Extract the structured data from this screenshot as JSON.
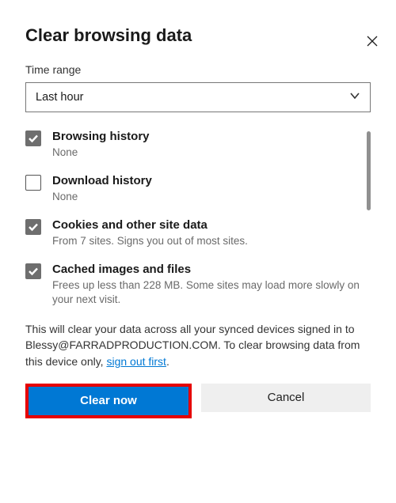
{
  "title": "Clear browsing data",
  "close_icon": "close",
  "time_range": {
    "label": "Time range",
    "value": "Last hour"
  },
  "options": [
    {
      "checked": true,
      "label": "Browsing history",
      "desc": "None"
    },
    {
      "checked": false,
      "label": "Download history",
      "desc": "None"
    },
    {
      "checked": true,
      "label": "Cookies and other site data",
      "desc": "From 7 sites. Signs you out of most sites."
    },
    {
      "checked": true,
      "label": "Cached images and files",
      "desc": "Frees up less than 228 MB. Some sites may load more slowly on your next visit."
    }
  ],
  "summary": {
    "text_before": "This will clear your data across all your synced devices signed in to Blessy@FARRADPRODUCTION.COM. To clear browsing data from this device only, ",
    "link_text": "sign out first",
    "text_after": "."
  },
  "buttons": {
    "primary": "Clear now",
    "secondary": "Cancel"
  }
}
